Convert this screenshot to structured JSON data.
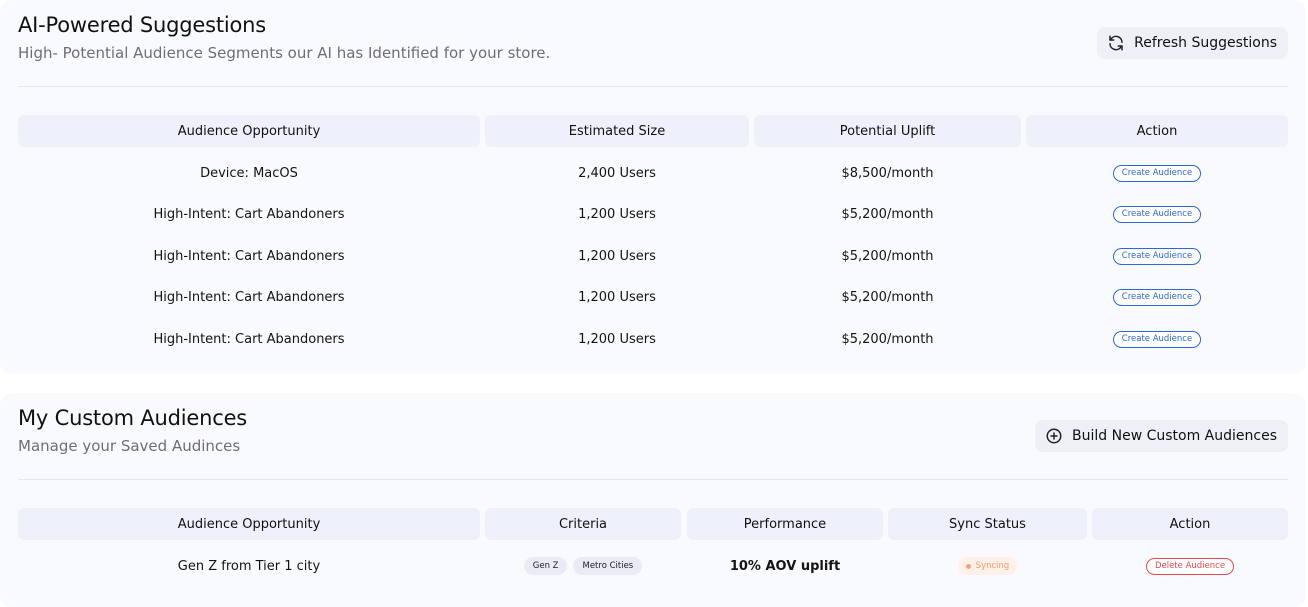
{
  "ai_section": {
    "title": "AI-Powered Suggestions",
    "subtitle": "High- Potential Audience Segments our AI has Identified for your store.",
    "refresh_button": {
      "label": "Refresh Suggestions",
      "icon": "refresh-icon"
    },
    "columns": [
      "Audience Opportunity",
      "Estimated Size",
      "Potential Uplift",
      "Action"
    ],
    "rows": [
      {
        "audience": "Device: MacOS",
        "size": "2,400 Users",
        "uplift": "$8,500/month",
        "action": "Create Audience"
      },
      {
        "audience": "High-Intent: Cart Abandoners",
        "size": "1,200 Users",
        "uplift": "$5,200/month",
        "action": "Create Audience"
      },
      {
        "audience": "High-Intent: Cart Abandoners",
        "size": "1,200 Users",
        "uplift": "$5,200/month",
        "action": "Create Audience"
      },
      {
        "audience": "High-Intent: Cart Abandoners",
        "size": "1,200 Users",
        "uplift": "$5,200/month",
        "action": "Create Audience"
      },
      {
        "audience": "High-Intent: Cart Abandoners",
        "size": "1,200 Users",
        "uplift": "$5,200/month",
        "action": "Create Audience"
      }
    ]
  },
  "custom_section": {
    "title": "My Custom Audiences",
    "subtitle": "Manage your Saved Audinces",
    "build_button": {
      "label": "Build New Custom Audiences",
      "icon": "plus-circle-icon"
    },
    "columns": [
      "Audience Opportunity",
      "Criteria",
      "Performance",
      "Sync Status",
      "Action"
    ],
    "rows": [
      {
        "audience": "Gen Z from Tier 1 city",
        "criteria": [
          "Gen Z",
          "Metro Cities"
        ],
        "performance": "10% AOV uplift",
        "sync_status": "Syncing",
        "action": "Delete Audience"
      }
    ]
  },
  "colors": {
    "panel_bg": "#f9fafe",
    "header_cell_bg": "#eef1fb",
    "primary_blue": "#2d66d6",
    "danger_red": "#e5484d",
    "syncing_orange": "#f29a6a"
  }
}
